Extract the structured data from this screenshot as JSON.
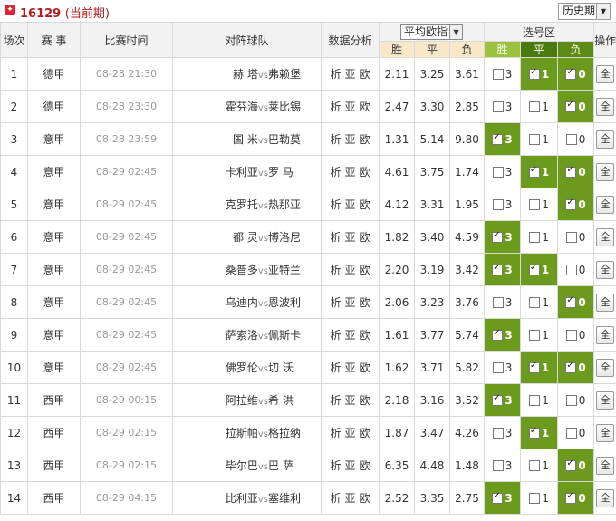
{
  "header": {
    "period_number": "16129",
    "period_note": "(当前期)",
    "history_label": "历史期"
  },
  "columns": {
    "match_no": "场次",
    "league": "赛 事",
    "time": "比赛时间",
    "teams": "对阵球队",
    "analysis": "数据分析",
    "odds_select": "平均欧指",
    "odds_win": "胜",
    "odds_draw": "平",
    "odds_loss": "负",
    "pick_area": "选号区",
    "pick_win": "胜",
    "pick_draw": "平",
    "pick_loss": "负",
    "action": "操作"
  },
  "analysis_links": [
    "析",
    "亚",
    "欧"
  ],
  "action_label": "全",
  "matches": [
    {
      "no": "1",
      "league": "德甲",
      "time": "08-28 21:30",
      "home": "赫 塔",
      "away": "弗赖堡",
      "odds": [
        "2.11",
        "3.25",
        "3.61"
      ],
      "picks": [
        false,
        true,
        true
      ]
    },
    {
      "no": "2",
      "league": "德甲",
      "time": "08-28 23:30",
      "home": "霍芬海",
      "away": "莱比锡",
      "odds": [
        "2.47",
        "3.30",
        "2.85"
      ],
      "picks": [
        false,
        false,
        true
      ]
    },
    {
      "no": "3",
      "league": "意甲",
      "time": "08-28 23:59",
      "home": "国 米",
      "away": "巴勒莫",
      "odds": [
        "1.31",
        "5.14",
        "9.80"
      ],
      "picks": [
        true,
        false,
        false
      ]
    },
    {
      "no": "4",
      "league": "意甲",
      "time": "08-29 02:45",
      "home": "卡利亚",
      "away": "罗 马",
      "odds": [
        "4.61",
        "3.75",
        "1.74"
      ],
      "picks": [
        false,
        true,
        true
      ]
    },
    {
      "no": "5",
      "league": "意甲",
      "time": "08-29 02:45",
      "home": "克罗托",
      "away": "热那亚",
      "odds": [
        "4.12",
        "3.31",
        "1.95"
      ],
      "picks": [
        false,
        false,
        true
      ]
    },
    {
      "no": "6",
      "league": "意甲",
      "time": "08-29 02:45",
      "home": "都 灵",
      "away": "博洛尼",
      "odds": [
        "1.82",
        "3.40",
        "4.59"
      ],
      "picks": [
        true,
        false,
        false
      ]
    },
    {
      "no": "7",
      "league": "意甲",
      "time": "08-29 02:45",
      "home": "桑普多",
      "away": "亚特兰",
      "odds": [
        "2.20",
        "3.19",
        "3.42"
      ],
      "picks": [
        true,
        true,
        false
      ]
    },
    {
      "no": "8",
      "league": "意甲",
      "time": "08-29 02:45",
      "home": "乌迪内",
      "away": "恩波利",
      "odds": [
        "2.06",
        "3.23",
        "3.76"
      ],
      "picks": [
        false,
        false,
        true
      ]
    },
    {
      "no": "9",
      "league": "意甲",
      "time": "08-29 02:45",
      "home": "萨索洛",
      "away": "佩斯卡",
      "odds": [
        "1.61",
        "3.77",
        "5.74"
      ],
      "picks": [
        true,
        false,
        false
      ]
    },
    {
      "no": "10",
      "league": "意甲",
      "time": "08-29 02:45",
      "home": "佛罗伦",
      "away": "切 沃",
      "odds": [
        "1.62",
        "3.71",
        "5.82"
      ],
      "picks": [
        false,
        true,
        true
      ]
    },
    {
      "no": "11",
      "league": "西甲",
      "time": "08-29 00:15",
      "home": "阿拉维",
      "away": "希 洪",
      "odds": [
        "2.18",
        "3.16",
        "3.52"
      ],
      "picks": [
        true,
        false,
        false
      ]
    },
    {
      "no": "12",
      "league": "西甲",
      "time": "08-29 02:15",
      "home": "拉斯帕",
      "away": "格拉纳",
      "odds": [
        "1.87",
        "3.47",
        "4.26"
      ],
      "picks": [
        false,
        true,
        false
      ]
    },
    {
      "no": "13",
      "league": "西甲",
      "time": "08-29 02:15",
      "home": "毕尔巴",
      "away": "巴 萨",
      "odds": [
        "6.35",
        "4.48",
        "1.48"
      ],
      "picks": [
        false,
        false,
        true
      ]
    },
    {
      "no": "14",
      "league": "西甲",
      "time": "08-29 04:15",
      "home": "比利亚",
      "away": "塞维利",
      "odds": [
        "2.52",
        "3.35",
        "2.75"
      ],
      "picks": [
        true,
        false,
        true
      ]
    }
  ],
  "pick_values": [
    "3",
    "1",
    "0"
  ],
  "vs_text": "vs"
}
